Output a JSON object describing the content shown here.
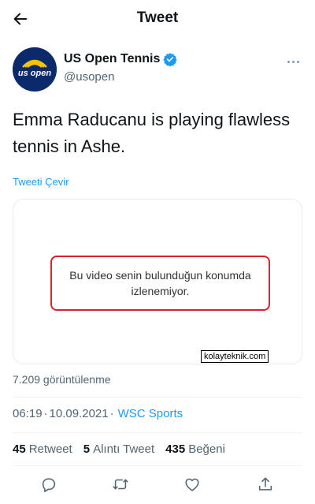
{
  "header": {
    "title": "Tweet"
  },
  "author": {
    "name": "US Open Tennis",
    "handle": "@usopen",
    "verified": true,
    "avatar_text": "us open"
  },
  "tweet": {
    "text": "Emma Raducanu is playing flawless tennis in Ashe."
  },
  "translate_label": "Tweeti Çevir",
  "media": {
    "notice_line1": "Bu video senin bulunduğun konumda",
    "notice_line2": "izlenemiyor.",
    "watermark": "kolayteknik.com"
  },
  "views": "7.209 görüntülenme",
  "meta": {
    "time": "06:19",
    "separator": "·",
    "date": "10.09.2021",
    "source": "WSC Sports"
  },
  "stats": {
    "retweets_count": "45",
    "retweets_label": "Retweet",
    "quotes_count": "5",
    "quotes_label": "Alıntı Tweet",
    "likes_count": "435",
    "likes_label": "Beğeni"
  },
  "colors": {
    "accent": "#1d9bf0",
    "text": "#0f1419",
    "secondary": "#536471",
    "notice_border": "#e0202a",
    "avatar_bg": "#0b2a6b"
  },
  "icons": [
    "back-arrow-icon",
    "verified-badge-icon",
    "more-icon",
    "reply-icon",
    "retweet-icon",
    "like-icon",
    "share-icon"
  ]
}
